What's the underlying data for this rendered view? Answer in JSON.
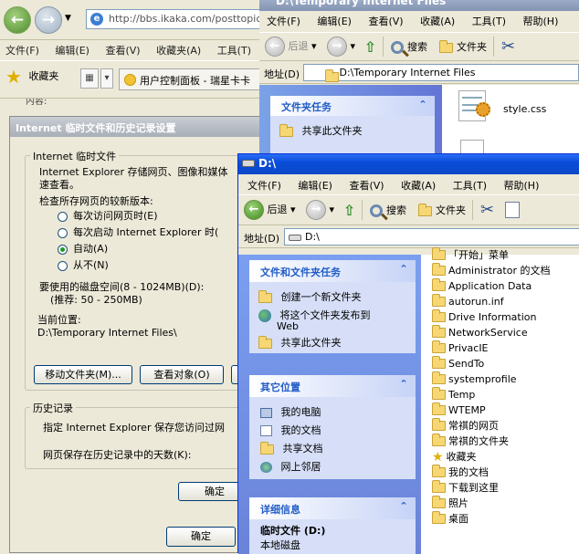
{
  "ie": {
    "address_url": "http://bbs.ikaka.com/posttopic.as",
    "menu": [
      "文件(F)",
      "编辑(E)",
      "查看(V)",
      "收藏夹(A)",
      "工具(T)"
    ],
    "favorites_label": "收藏夹",
    "tab_title": "用户控制面板 - 瑞星卡卡",
    "partial_text": "内容:"
  },
  "settings_dialog": {
    "title": "Internet 临时文件和历史记录设置",
    "temp_group_label": "Internet 临时文件",
    "temp_desc_1": "Internet Explorer 存储网页、图像和媒体",
    "temp_desc_2": "速查看。",
    "check_label": "检查所存网页的较新版本:",
    "radio_options": [
      {
        "label": "每次访问网页时(E)",
        "selected": false
      },
      {
        "label": "每次启动 Internet Explorer 时(",
        "selected": false
      },
      {
        "label": "自动(A)",
        "selected": true
      },
      {
        "label": "从不(N)",
        "selected": false
      }
    ],
    "disk_label": "要使用的磁盘空间(8 - 1024MB)(D):",
    "disk_recommend": "(推荐: 50 - 250MB)",
    "location_label": "当前位置:",
    "location_value": "D:\\Temporary Internet Files\\",
    "move_button": "移动文件夹(M)...",
    "view_objects_button": "查看对象(O)",
    "history_group_label": "历史记录",
    "history_desc": "指定 Internet Explorer 保存您访问过网",
    "history_days_label": "网页保存在历史记录中的天数(K):",
    "ok_button": "确定",
    "ok_button_outer": "确定"
  },
  "explorer_temp": {
    "title": "D:\\Temporary Internet Files",
    "menu": [
      "文件(F)",
      "编辑(E)",
      "查看(V)",
      "收藏(A)",
      "工具(T)",
      "帮助(H)"
    ],
    "toolbar": {
      "back": "后退",
      "search": "搜索",
      "folders": "文件夹"
    },
    "address_label": "地址(D)",
    "address_value": "D:\\Temporary Internet Files",
    "task_header": "文件夹任务",
    "task_share": "共享此文件夹",
    "file_name": "style.css"
  },
  "explorer_d": {
    "title": "D:\\",
    "menu": [
      "文件(F)",
      "编辑(E)",
      "查看(V)",
      "收藏(A)",
      "工具(T)",
      "帮助(H)"
    ],
    "toolbar": {
      "back": "后退",
      "search": "搜索",
      "folders": "文件夹"
    },
    "address_label": "地址(D)",
    "address_value": "D:\\",
    "tasks": {
      "header": "文件和文件夹任务",
      "items": [
        "创建一个新文件夹",
        "将这个文件夹发布到",
        "Web",
        "共享此文件夹"
      ]
    },
    "other_places": {
      "header": "其它位置",
      "items": [
        "我的电脑",
        "我的文档",
        "共享文档",
        "网上邻居"
      ]
    },
    "details": {
      "header": "详细信息",
      "name": "临时文件 (D:)",
      "type": "本地磁盘"
    },
    "files": [
      {
        "name": "「开始」菜单",
        "icon": "folder"
      },
      {
        "name": "Administrator 的文档",
        "icon": "folder"
      },
      {
        "name": "Application Data",
        "icon": "folder"
      },
      {
        "name": "autorun.inf",
        "icon": "folder"
      },
      {
        "name": "Drive Information",
        "icon": "folder"
      },
      {
        "name": "NetworkService",
        "icon": "folder"
      },
      {
        "name": "PrivacIE",
        "icon": "folder"
      },
      {
        "name": "SendTo",
        "icon": "folder"
      },
      {
        "name": "systemprofile",
        "icon": "folder"
      },
      {
        "name": "Temp",
        "icon": "folder"
      },
      {
        "name": "WTEMP",
        "icon": "folder"
      },
      {
        "name": "常祺的网页",
        "icon": "folder"
      },
      {
        "name": "常祺的文件夹",
        "icon": "folder"
      },
      {
        "name": "收藏夹",
        "icon": "star"
      },
      {
        "name": "我的文档",
        "icon": "folder"
      },
      {
        "name": "下载到这里",
        "icon": "folder"
      },
      {
        "name": "照片",
        "icon": "folder"
      },
      {
        "name": "桌面",
        "icon": "folder"
      }
    ]
  }
}
